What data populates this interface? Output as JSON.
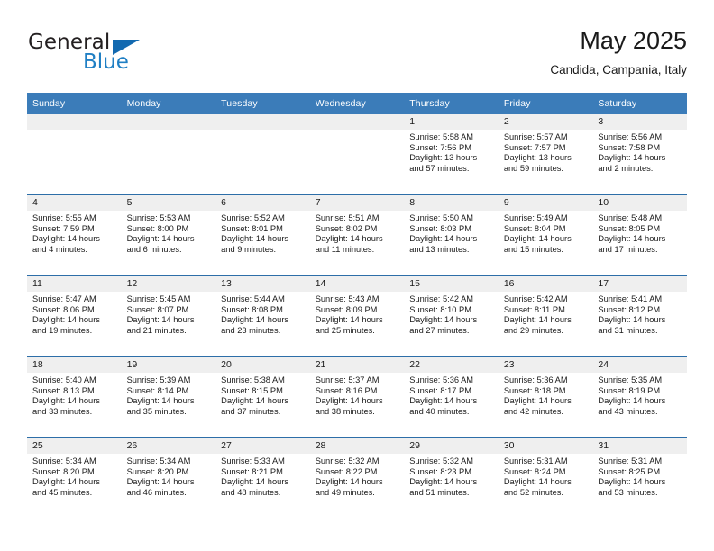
{
  "brand": {
    "name_part1": "General",
    "name_part2": "Blue",
    "logo_icon": "triangle-logo-icon"
  },
  "header": {
    "title": "May 2025",
    "subtitle": "Candida, Campania, Italy"
  },
  "colors": {
    "header_blue": "#3b7cb9",
    "row_separator_blue": "#2d6ea8",
    "daynum_band_gray": "#efefef",
    "brand_blue": "#1f7fc4",
    "logo_triangle_blue": "#1269b0"
  },
  "weekday_headers": [
    "Sunday",
    "Monday",
    "Tuesday",
    "Wednesday",
    "Thursday",
    "Friday",
    "Saturday"
  ],
  "weeks": [
    [
      {
        "day": "",
        "empty": true,
        "sunrise": "",
        "sunset": "",
        "daylight_line1": "",
        "daylight_line2": ""
      },
      {
        "day": "",
        "empty": true,
        "sunrise": "",
        "sunset": "",
        "daylight_line1": "",
        "daylight_line2": ""
      },
      {
        "day": "",
        "empty": true,
        "sunrise": "",
        "sunset": "",
        "daylight_line1": "",
        "daylight_line2": ""
      },
      {
        "day": "",
        "empty": true,
        "sunrise": "",
        "sunset": "",
        "daylight_line1": "",
        "daylight_line2": ""
      },
      {
        "day": "1",
        "empty": false,
        "sunrise": "Sunrise: 5:58 AM",
        "sunset": "Sunset: 7:56 PM",
        "daylight_line1": "Daylight: 13 hours",
        "daylight_line2": "and 57 minutes."
      },
      {
        "day": "2",
        "empty": false,
        "sunrise": "Sunrise: 5:57 AM",
        "sunset": "Sunset: 7:57 PM",
        "daylight_line1": "Daylight: 13 hours",
        "daylight_line2": "and 59 minutes."
      },
      {
        "day": "3",
        "empty": false,
        "sunrise": "Sunrise: 5:56 AM",
        "sunset": "Sunset: 7:58 PM",
        "daylight_line1": "Daylight: 14 hours",
        "daylight_line2": "and 2 minutes."
      }
    ],
    [
      {
        "day": "4",
        "empty": false,
        "sunrise": "Sunrise: 5:55 AM",
        "sunset": "Sunset: 7:59 PM",
        "daylight_line1": "Daylight: 14 hours",
        "daylight_line2": "and 4 minutes."
      },
      {
        "day": "5",
        "empty": false,
        "sunrise": "Sunrise: 5:53 AM",
        "sunset": "Sunset: 8:00 PM",
        "daylight_line1": "Daylight: 14 hours",
        "daylight_line2": "and 6 minutes."
      },
      {
        "day": "6",
        "empty": false,
        "sunrise": "Sunrise: 5:52 AM",
        "sunset": "Sunset: 8:01 PM",
        "daylight_line1": "Daylight: 14 hours",
        "daylight_line2": "and 9 minutes."
      },
      {
        "day": "7",
        "empty": false,
        "sunrise": "Sunrise: 5:51 AM",
        "sunset": "Sunset: 8:02 PM",
        "daylight_line1": "Daylight: 14 hours",
        "daylight_line2": "and 11 minutes."
      },
      {
        "day": "8",
        "empty": false,
        "sunrise": "Sunrise: 5:50 AM",
        "sunset": "Sunset: 8:03 PM",
        "daylight_line1": "Daylight: 14 hours",
        "daylight_line2": "and 13 minutes."
      },
      {
        "day": "9",
        "empty": false,
        "sunrise": "Sunrise: 5:49 AM",
        "sunset": "Sunset: 8:04 PM",
        "daylight_line1": "Daylight: 14 hours",
        "daylight_line2": "and 15 minutes."
      },
      {
        "day": "10",
        "empty": false,
        "sunrise": "Sunrise: 5:48 AM",
        "sunset": "Sunset: 8:05 PM",
        "daylight_line1": "Daylight: 14 hours",
        "daylight_line2": "and 17 minutes."
      }
    ],
    [
      {
        "day": "11",
        "empty": false,
        "sunrise": "Sunrise: 5:47 AM",
        "sunset": "Sunset: 8:06 PM",
        "daylight_line1": "Daylight: 14 hours",
        "daylight_line2": "and 19 minutes."
      },
      {
        "day": "12",
        "empty": false,
        "sunrise": "Sunrise: 5:45 AM",
        "sunset": "Sunset: 8:07 PM",
        "daylight_line1": "Daylight: 14 hours",
        "daylight_line2": "and 21 minutes."
      },
      {
        "day": "13",
        "empty": false,
        "sunrise": "Sunrise: 5:44 AM",
        "sunset": "Sunset: 8:08 PM",
        "daylight_line1": "Daylight: 14 hours",
        "daylight_line2": "and 23 minutes."
      },
      {
        "day": "14",
        "empty": false,
        "sunrise": "Sunrise: 5:43 AM",
        "sunset": "Sunset: 8:09 PM",
        "daylight_line1": "Daylight: 14 hours",
        "daylight_line2": "and 25 minutes."
      },
      {
        "day": "15",
        "empty": false,
        "sunrise": "Sunrise: 5:42 AM",
        "sunset": "Sunset: 8:10 PM",
        "daylight_line1": "Daylight: 14 hours",
        "daylight_line2": "and 27 minutes."
      },
      {
        "day": "16",
        "empty": false,
        "sunrise": "Sunrise: 5:42 AM",
        "sunset": "Sunset: 8:11 PM",
        "daylight_line1": "Daylight: 14 hours",
        "daylight_line2": "and 29 minutes."
      },
      {
        "day": "17",
        "empty": false,
        "sunrise": "Sunrise: 5:41 AM",
        "sunset": "Sunset: 8:12 PM",
        "daylight_line1": "Daylight: 14 hours",
        "daylight_line2": "and 31 minutes."
      }
    ],
    [
      {
        "day": "18",
        "empty": false,
        "sunrise": "Sunrise: 5:40 AM",
        "sunset": "Sunset: 8:13 PM",
        "daylight_line1": "Daylight: 14 hours",
        "daylight_line2": "and 33 minutes."
      },
      {
        "day": "19",
        "empty": false,
        "sunrise": "Sunrise: 5:39 AM",
        "sunset": "Sunset: 8:14 PM",
        "daylight_line1": "Daylight: 14 hours",
        "daylight_line2": "and 35 minutes."
      },
      {
        "day": "20",
        "empty": false,
        "sunrise": "Sunrise: 5:38 AM",
        "sunset": "Sunset: 8:15 PM",
        "daylight_line1": "Daylight: 14 hours",
        "daylight_line2": "and 37 minutes."
      },
      {
        "day": "21",
        "empty": false,
        "sunrise": "Sunrise: 5:37 AM",
        "sunset": "Sunset: 8:16 PM",
        "daylight_line1": "Daylight: 14 hours",
        "daylight_line2": "and 38 minutes."
      },
      {
        "day": "22",
        "empty": false,
        "sunrise": "Sunrise: 5:36 AM",
        "sunset": "Sunset: 8:17 PM",
        "daylight_line1": "Daylight: 14 hours",
        "daylight_line2": "and 40 minutes."
      },
      {
        "day": "23",
        "empty": false,
        "sunrise": "Sunrise: 5:36 AM",
        "sunset": "Sunset: 8:18 PM",
        "daylight_line1": "Daylight: 14 hours",
        "daylight_line2": "and 42 minutes."
      },
      {
        "day": "24",
        "empty": false,
        "sunrise": "Sunrise: 5:35 AM",
        "sunset": "Sunset: 8:19 PM",
        "daylight_line1": "Daylight: 14 hours",
        "daylight_line2": "and 43 minutes."
      }
    ],
    [
      {
        "day": "25",
        "empty": false,
        "sunrise": "Sunrise: 5:34 AM",
        "sunset": "Sunset: 8:20 PM",
        "daylight_line1": "Daylight: 14 hours",
        "daylight_line2": "and 45 minutes."
      },
      {
        "day": "26",
        "empty": false,
        "sunrise": "Sunrise: 5:34 AM",
        "sunset": "Sunset: 8:20 PM",
        "daylight_line1": "Daylight: 14 hours",
        "daylight_line2": "and 46 minutes."
      },
      {
        "day": "27",
        "empty": false,
        "sunrise": "Sunrise: 5:33 AM",
        "sunset": "Sunset: 8:21 PM",
        "daylight_line1": "Daylight: 14 hours",
        "daylight_line2": "and 48 minutes."
      },
      {
        "day": "28",
        "empty": false,
        "sunrise": "Sunrise: 5:32 AM",
        "sunset": "Sunset: 8:22 PM",
        "daylight_line1": "Daylight: 14 hours",
        "daylight_line2": "and 49 minutes."
      },
      {
        "day": "29",
        "empty": false,
        "sunrise": "Sunrise: 5:32 AM",
        "sunset": "Sunset: 8:23 PM",
        "daylight_line1": "Daylight: 14 hours",
        "daylight_line2": "and 51 minutes."
      },
      {
        "day": "30",
        "empty": false,
        "sunrise": "Sunrise: 5:31 AM",
        "sunset": "Sunset: 8:24 PM",
        "daylight_line1": "Daylight: 14 hours",
        "daylight_line2": "and 52 minutes."
      },
      {
        "day": "31",
        "empty": false,
        "sunrise": "Sunrise: 5:31 AM",
        "sunset": "Sunset: 8:25 PM",
        "daylight_line1": "Daylight: 14 hours",
        "daylight_line2": "and 53 minutes."
      }
    ]
  ]
}
